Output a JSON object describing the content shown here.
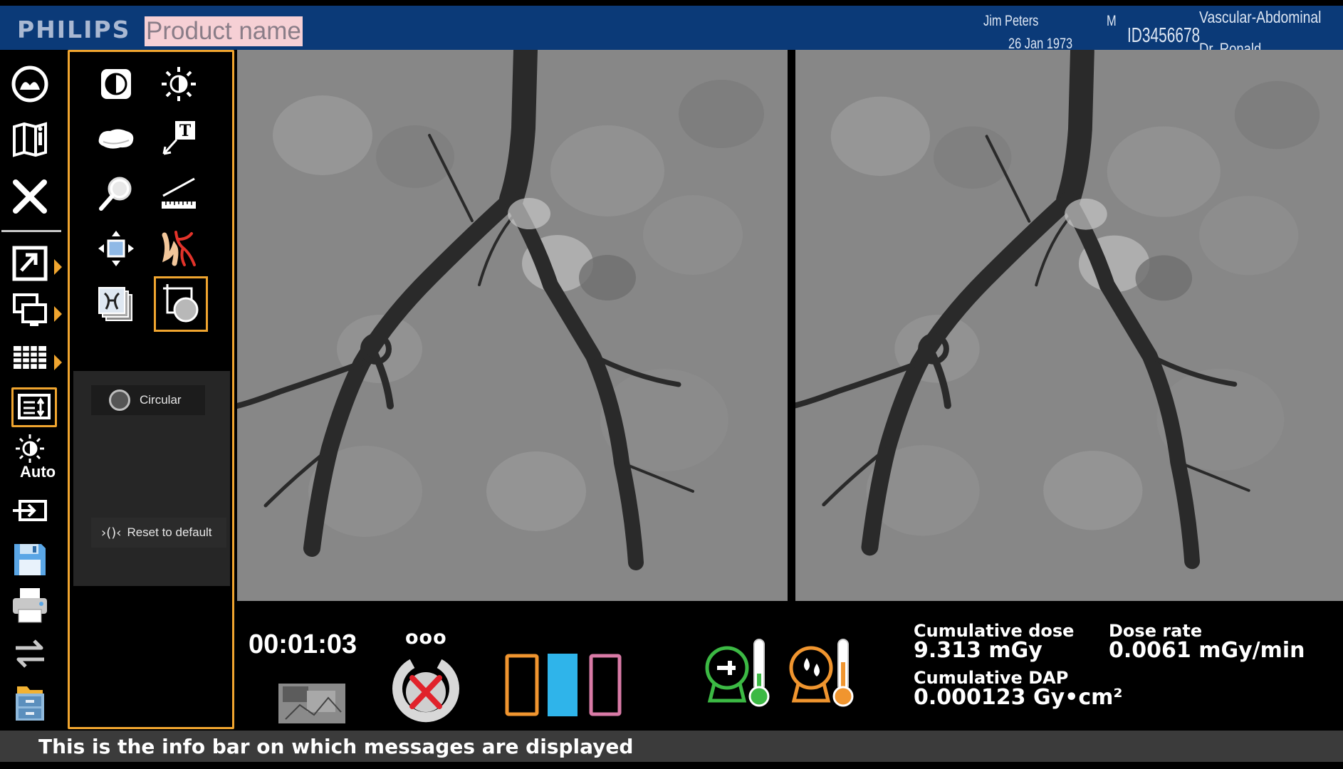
{
  "header": {
    "logo": "PHILIPS",
    "product_name": "Product name",
    "patient_name": "Jim Peters",
    "patient_sex": "M",
    "patient_dob": "26 Jan 1973",
    "patient_id": "ID3456678",
    "procedure": "Vascular-Abdominal",
    "physician": "Dr. Ronald"
  },
  "left_toolbar": {
    "items": [
      {
        "icon": "rotate-view-icon"
      },
      {
        "icon": "patient-info-icon"
      },
      {
        "icon": "close-icon"
      },
      {
        "icon": "play-review-icon",
        "has_submenu": true
      },
      {
        "icon": "display-monitors-icon",
        "has_submenu": true
      },
      {
        "icon": "grid-layout-icon",
        "has_submenu": true
      },
      {
        "icon": "info-panel-icon",
        "selected": true
      },
      {
        "icon": "auto-brightness-icon",
        "label": "Auto"
      },
      {
        "icon": "export-icon"
      },
      {
        "icon": "save-disk-icon"
      },
      {
        "icon": "print-icon"
      },
      {
        "icon": "transfer-icon"
      },
      {
        "icon": "archive-cabinet-icon"
      }
    ]
  },
  "tool_panel": {
    "tools": [
      {
        "icon": "contrast-icon"
      },
      {
        "icon": "brightness-icon"
      },
      {
        "icon": "stone-shape-icon"
      },
      {
        "icon": "text-annotation-icon"
      },
      {
        "icon": "magnifier-icon"
      },
      {
        "icon": "ruler-measure-icon"
      },
      {
        "icon": "pan-move-icon"
      },
      {
        "icon": "vessel-anatomy-icon"
      },
      {
        "icon": "image-stack-icon"
      },
      {
        "icon": "shutter-circular-icon",
        "active": true
      }
    ],
    "options": {
      "shape_option": "Circular",
      "reset_label": "Reset to default"
    }
  },
  "status": {
    "timer": "00:01:03",
    "indicator_dots": "ooo",
    "layout_colors": [
      "#f0952f",
      "#2fb4ea",
      "#d97aa6"
    ],
    "cumulative_dose_label": "Cumulative dose",
    "cumulative_dose_value": "9.313 mGy",
    "dose_rate_label": "Dose rate",
    "dose_rate_value": "0.0061 mGy/min",
    "cumulative_dap_label": "Cumulative DAP",
    "cumulative_dap_value": "0.000123 Gy•cm²",
    "tube_temp_color": "#3cb944",
    "heat_temp_color": "#f0952f"
  },
  "info_bar": {
    "message": "This is the info bar on which messages are displayed"
  }
}
